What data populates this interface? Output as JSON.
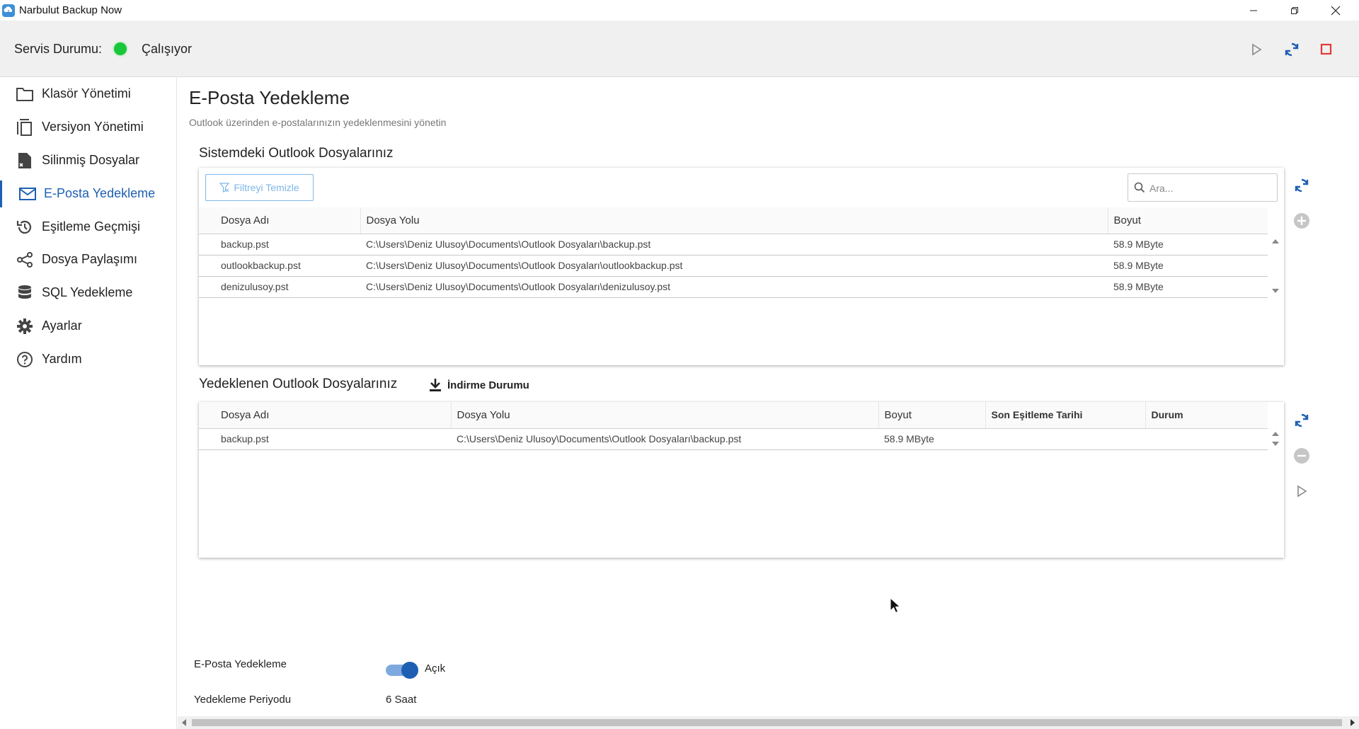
{
  "window": {
    "title": "Narbulut Backup Now",
    "icons": [
      "app-logo-icon",
      "minimize-icon",
      "restore-icon",
      "close-icon"
    ]
  },
  "status": {
    "label": "Servis Durumu:",
    "state": "Çalışıyor",
    "state_color": "#19c73a",
    "actions": [
      "play-icon",
      "refresh-icon",
      "stop-icon"
    ]
  },
  "sidebar": {
    "items": [
      {
        "label": "Klasör Yönetimi",
        "icon": "folder-icon"
      },
      {
        "label": "Versiyon Yönetimi",
        "icon": "copy-icon"
      },
      {
        "label": "Silinmiş Dosyalar",
        "icon": "deleted-file-icon"
      },
      {
        "label": "E-Posta Yedekleme",
        "icon": "mail-icon",
        "active": true
      },
      {
        "label": "Eşitleme Geçmişi",
        "icon": "history-icon"
      },
      {
        "label": "Dosya Paylaşımı",
        "icon": "share-icon"
      },
      {
        "label": "SQL Yedekleme",
        "icon": "database-icon"
      },
      {
        "label": "Ayarlar",
        "icon": "gear-icon"
      },
      {
        "label": "Yardım",
        "icon": "help-icon"
      }
    ],
    "active_color": "#1e5fb3"
  },
  "page": {
    "title": "E-Posta Yedekleme",
    "subtitle": "Outlook üzerinden e-postalarınızın yedeklenmesini yönetin"
  },
  "system_files": {
    "title": "Sistemdeki Outlook Dosyalarınız",
    "filter_button": "Filtreyi Temizle",
    "search_placeholder": "Ara...",
    "columns": [
      "Dosya Adı",
      "Dosya Yolu",
      "Boyut"
    ],
    "rows": [
      [
        "backup.pst",
        "C:\\Users\\Deniz Ulusoy\\Documents\\Outlook Dosyaları\\backup.pst",
        "58.9 MByte"
      ],
      [
        "outlookbackup.pst",
        "C:\\Users\\Deniz Ulusoy\\Documents\\Outlook Dosyaları\\outlookbackup.pst",
        "58.9 MByte"
      ],
      [
        "denizulusoy.pst",
        "C:\\Users\\Deniz Ulusoy\\Documents\\Outlook Dosyaları\\denizulusoy.pst",
        "58.9 MByte"
      ]
    ],
    "actions": [
      "refresh-icon",
      "add-circle-icon"
    ]
  },
  "backed_up_files": {
    "title": "Yedeklenen Outlook Dosyalarınız",
    "download_button": "İndirme Durumu",
    "columns": [
      "Dosya Adı",
      "Dosya Yolu",
      "Boyut",
      "Son Eşitleme Tarihi",
      "Durum"
    ],
    "rows": [
      [
        "backup.pst",
        "C:\\Users\\Deniz Ulusoy\\Documents\\Outlook Dosyaları\\backup.pst",
        "58.9 MByte",
        "",
        ""
      ]
    ],
    "actions": [
      "refresh-icon",
      "remove-circle-icon",
      "play-icon"
    ]
  },
  "settings": {
    "email_backup_label": "E-Posta Yedekleme",
    "email_backup_state": "Açık",
    "email_backup_on": true,
    "period_label": "Yedekleme Periyodu",
    "period_value": "6 Saat"
  },
  "colors": {
    "accent": "#1e5fb3",
    "filter_button": "#7eb6e8",
    "stop": "#e53935"
  }
}
